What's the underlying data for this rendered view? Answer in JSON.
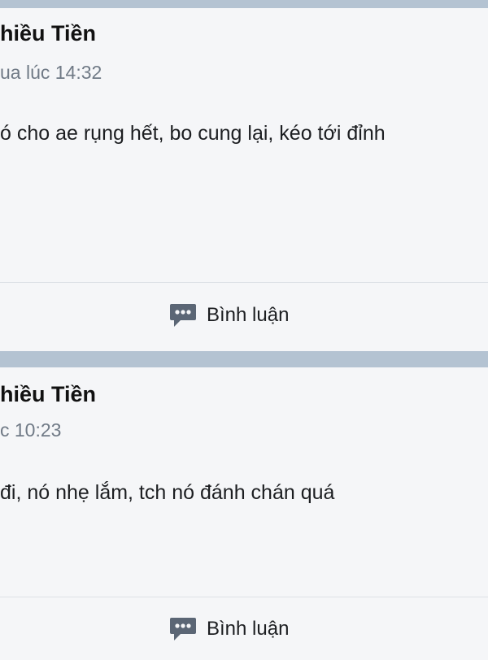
{
  "posts": [
    {
      "author": "hiều Tiền",
      "time": "ua lúc 14:32",
      "content": "ó cho ae rụng hết, bo cung lại, kéo tới đỉnh",
      "comment_label": "Bình luận"
    },
    {
      "author": "hiều Tiền",
      "time": "c 10:23",
      "content": "đi, nó nhẹ lắm, tch nó đánh chán quá",
      "comment_label": "Bình luận"
    }
  ],
  "colors": {
    "page_background": "#b4c3d2",
    "card_background": "#f5f6f8",
    "icon": "#5b6675",
    "muted_text": "#707a86"
  },
  "icons": {
    "comment": "comment-bubble-icon"
  }
}
